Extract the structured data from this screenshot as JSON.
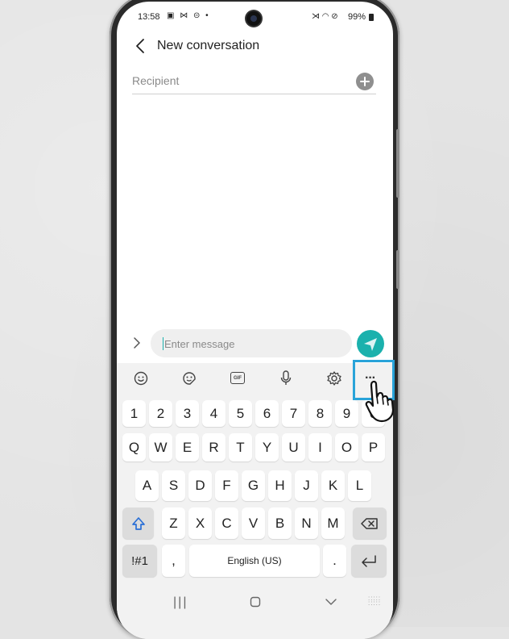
{
  "status": {
    "time": "13:58",
    "battery": "99%"
  },
  "header": {
    "title": "New conversation"
  },
  "recipient": {
    "placeholder": "Recipient"
  },
  "composer": {
    "placeholder": "Enter message"
  },
  "keyboard": {
    "numbers": [
      "1",
      "2",
      "3",
      "4",
      "5",
      "6",
      "7",
      "8",
      "9",
      "0"
    ],
    "row1": [
      "Q",
      "W",
      "E",
      "R",
      "T",
      "Y",
      "U",
      "I",
      "O",
      "P"
    ],
    "row2": [
      "A",
      "S",
      "D",
      "F",
      "G",
      "H",
      "J",
      "K",
      "L"
    ],
    "row3": [
      "Z",
      "X",
      "C",
      "V",
      "B",
      "N",
      "M"
    ],
    "symbols_label": "!#1",
    "comma": ",",
    "space_label": "English (US)",
    "period": ".",
    "gif_label": "GIF",
    "more_label": "···"
  },
  "colors": {
    "accent": "#1bb1ad",
    "highlight": "#29a3d9",
    "shift": "#2a6fd6"
  }
}
